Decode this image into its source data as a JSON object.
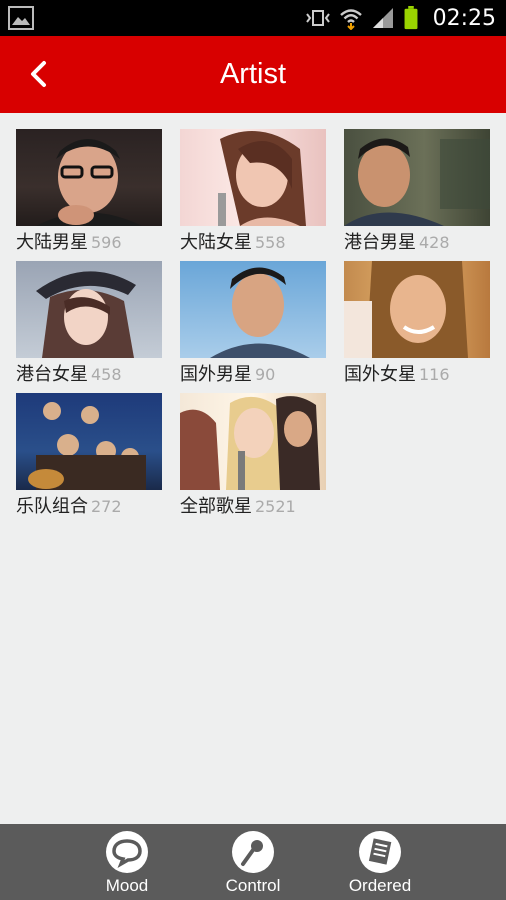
{
  "status_bar": {
    "time": "02:25",
    "icons": [
      "gallery-notification-icon",
      "vibrate-icon",
      "wifi-icon",
      "signal-icon",
      "battery-icon"
    ]
  },
  "header": {
    "title": "Artist",
    "back_icon": "chevron-left-icon"
  },
  "colors": {
    "header": "#d80000",
    "status_bar": "#000000",
    "background": "#eeefef",
    "bottom_bar": "#5b5b5b",
    "count_text": "#aaaaaa",
    "battery": "#9ad400"
  },
  "categories": [
    {
      "name": "大陆男星",
      "count": "596"
    },
    {
      "name": "大陆女星",
      "count": "558"
    },
    {
      "name": "港台男星",
      "count": "428"
    },
    {
      "name": "港台女星",
      "count": "458"
    },
    {
      "name": "国外男星",
      "count": "90"
    },
    {
      "name": "国外女星",
      "count": "116"
    },
    {
      "name": "乐队组合",
      "count": "272"
    },
    {
      "name": "全部歌星",
      "count": "2521"
    }
  ],
  "bottom_nav": [
    {
      "label": "Mood",
      "icon": "speech-bubble-icon"
    },
    {
      "label": "Control",
      "icon": "microphone-icon"
    },
    {
      "label": "Ordered",
      "icon": "list-icon"
    }
  ]
}
